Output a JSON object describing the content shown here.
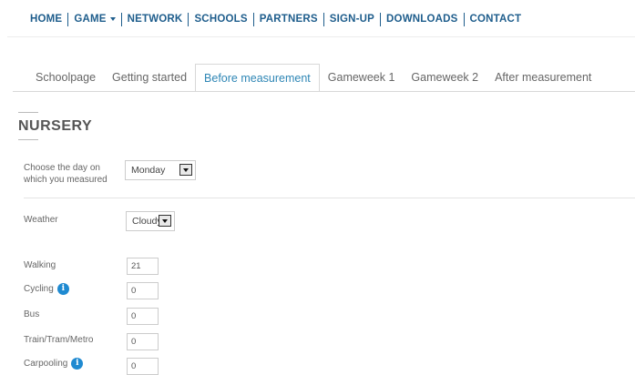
{
  "nav": {
    "items": [
      "HOME",
      "GAME",
      "NETWORK",
      "SCHOOLS",
      "PARTNERS",
      "SIGN-UP",
      "DOWNLOADS",
      "CONTACT"
    ]
  },
  "tabs": [
    "Schoolpage",
    "Getting started",
    "Before measurement",
    "Gameweek 1",
    "Gameweek 2",
    "After measurement"
  ],
  "active_tab": "Before measurement",
  "section": {
    "title": "NURSERY"
  },
  "form": {
    "day_label": "Choose the day on which you measured",
    "day_value": "Monday",
    "weather_label": "Weather",
    "weather_value": "Cloudy",
    "transport": [
      {
        "label": "Walking",
        "value": "21",
        "info": false
      },
      {
        "label": "Cycling",
        "value": "0",
        "info": true
      },
      {
        "label": "Bus",
        "value": "0",
        "info": false
      },
      {
        "label": "Train/Tram/Metro",
        "value": "0",
        "info": false
      },
      {
        "label": "Carpooling",
        "value": "0",
        "info": true
      }
    ]
  },
  "icons": {
    "info": "info-icon",
    "dropdown": "chevron-down-icon",
    "nav_caret": "caret-down-icon"
  },
  "colors": {
    "nav": "#1e5d8c",
    "active_tab": "#2e86b5",
    "info": "#1f8ad1"
  }
}
